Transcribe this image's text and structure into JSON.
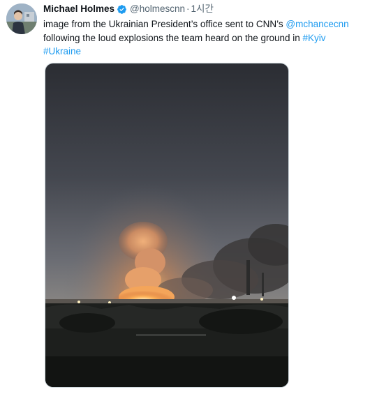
{
  "tweet": {
    "author_name": "Michael Holmes",
    "author_handle": "@holmescnn",
    "separator": "·",
    "time": "1시간",
    "text_part1": "image from the Ukrainian President’s office sent to CNN’s ",
    "mention": "@mchancecnn",
    "text_part2": " following the loud explosions the team heard on the ground in ",
    "hashtag1": "#Kyiv",
    "hashtag2": "#Ukraine"
  },
  "icons": {
    "verified": "verified-badge-icon"
  },
  "colors": {
    "link": "#1d9bf0",
    "secondary_text": "#536471",
    "primary_text": "#0f1419",
    "verified": "#1d9bf0"
  }
}
